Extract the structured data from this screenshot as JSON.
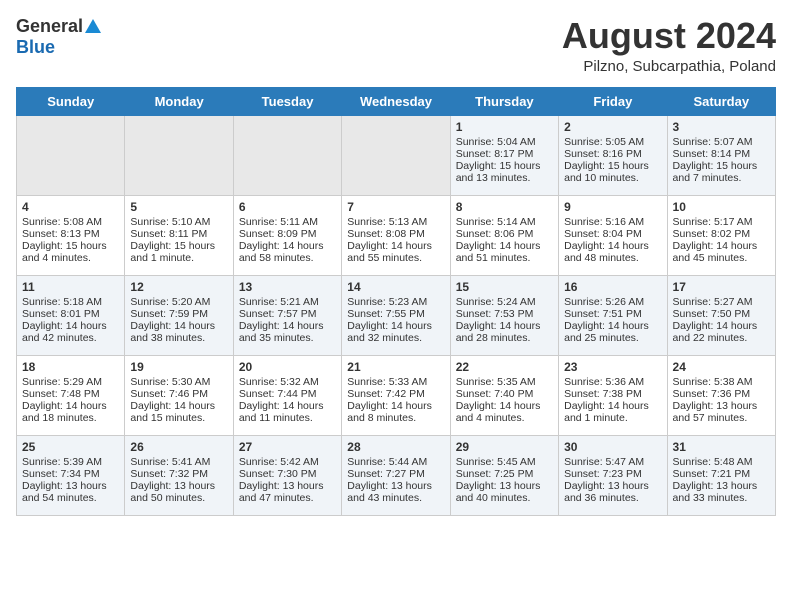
{
  "header": {
    "logo_general": "General",
    "logo_blue": "Blue",
    "month_year": "August 2024",
    "location": "Pilzno, Subcarpathia, Poland"
  },
  "days_of_week": [
    "Sunday",
    "Monday",
    "Tuesday",
    "Wednesday",
    "Thursday",
    "Friday",
    "Saturday"
  ],
  "weeks": [
    [
      {
        "day": "",
        "content": ""
      },
      {
        "day": "",
        "content": ""
      },
      {
        "day": "",
        "content": ""
      },
      {
        "day": "",
        "content": ""
      },
      {
        "day": "1",
        "content": "Sunrise: 5:04 AM\nSunset: 8:17 PM\nDaylight: 15 hours\nand 13 minutes."
      },
      {
        "day": "2",
        "content": "Sunrise: 5:05 AM\nSunset: 8:16 PM\nDaylight: 15 hours\nand 10 minutes."
      },
      {
        "day": "3",
        "content": "Sunrise: 5:07 AM\nSunset: 8:14 PM\nDaylight: 15 hours\nand 7 minutes."
      }
    ],
    [
      {
        "day": "4",
        "content": "Sunrise: 5:08 AM\nSunset: 8:13 PM\nDaylight: 15 hours\nand 4 minutes."
      },
      {
        "day": "5",
        "content": "Sunrise: 5:10 AM\nSunset: 8:11 PM\nDaylight: 15 hours\nand 1 minute."
      },
      {
        "day": "6",
        "content": "Sunrise: 5:11 AM\nSunset: 8:09 PM\nDaylight: 14 hours\nand 58 minutes."
      },
      {
        "day": "7",
        "content": "Sunrise: 5:13 AM\nSunset: 8:08 PM\nDaylight: 14 hours\nand 55 minutes."
      },
      {
        "day": "8",
        "content": "Sunrise: 5:14 AM\nSunset: 8:06 PM\nDaylight: 14 hours\nand 51 minutes."
      },
      {
        "day": "9",
        "content": "Sunrise: 5:16 AM\nSunset: 8:04 PM\nDaylight: 14 hours\nand 48 minutes."
      },
      {
        "day": "10",
        "content": "Sunrise: 5:17 AM\nSunset: 8:02 PM\nDaylight: 14 hours\nand 45 minutes."
      }
    ],
    [
      {
        "day": "11",
        "content": "Sunrise: 5:18 AM\nSunset: 8:01 PM\nDaylight: 14 hours\nand 42 minutes."
      },
      {
        "day": "12",
        "content": "Sunrise: 5:20 AM\nSunset: 7:59 PM\nDaylight: 14 hours\nand 38 minutes."
      },
      {
        "day": "13",
        "content": "Sunrise: 5:21 AM\nSunset: 7:57 PM\nDaylight: 14 hours\nand 35 minutes."
      },
      {
        "day": "14",
        "content": "Sunrise: 5:23 AM\nSunset: 7:55 PM\nDaylight: 14 hours\nand 32 minutes."
      },
      {
        "day": "15",
        "content": "Sunrise: 5:24 AM\nSunset: 7:53 PM\nDaylight: 14 hours\nand 28 minutes."
      },
      {
        "day": "16",
        "content": "Sunrise: 5:26 AM\nSunset: 7:51 PM\nDaylight: 14 hours\nand 25 minutes."
      },
      {
        "day": "17",
        "content": "Sunrise: 5:27 AM\nSunset: 7:50 PM\nDaylight: 14 hours\nand 22 minutes."
      }
    ],
    [
      {
        "day": "18",
        "content": "Sunrise: 5:29 AM\nSunset: 7:48 PM\nDaylight: 14 hours\nand 18 minutes."
      },
      {
        "day": "19",
        "content": "Sunrise: 5:30 AM\nSunset: 7:46 PM\nDaylight: 14 hours\nand 15 minutes."
      },
      {
        "day": "20",
        "content": "Sunrise: 5:32 AM\nSunset: 7:44 PM\nDaylight: 14 hours\nand 11 minutes."
      },
      {
        "day": "21",
        "content": "Sunrise: 5:33 AM\nSunset: 7:42 PM\nDaylight: 14 hours\nand 8 minutes."
      },
      {
        "day": "22",
        "content": "Sunrise: 5:35 AM\nSunset: 7:40 PM\nDaylight: 14 hours\nand 4 minutes."
      },
      {
        "day": "23",
        "content": "Sunrise: 5:36 AM\nSunset: 7:38 PM\nDaylight: 14 hours\nand 1 minute."
      },
      {
        "day": "24",
        "content": "Sunrise: 5:38 AM\nSunset: 7:36 PM\nDaylight: 13 hours\nand 57 minutes."
      }
    ],
    [
      {
        "day": "25",
        "content": "Sunrise: 5:39 AM\nSunset: 7:34 PM\nDaylight: 13 hours\nand 54 minutes."
      },
      {
        "day": "26",
        "content": "Sunrise: 5:41 AM\nSunset: 7:32 PM\nDaylight: 13 hours\nand 50 minutes."
      },
      {
        "day": "27",
        "content": "Sunrise: 5:42 AM\nSunset: 7:30 PM\nDaylight: 13 hours\nand 47 minutes."
      },
      {
        "day": "28",
        "content": "Sunrise: 5:44 AM\nSunset: 7:27 PM\nDaylight: 13 hours\nand 43 minutes."
      },
      {
        "day": "29",
        "content": "Sunrise: 5:45 AM\nSunset: 7:25 PM\nDaylight: 13 hours\nand 40 minutes."
      },
      {
        "day": "30",
        "content": "Sunrise: 5:47 AM\nSunset: 7:23 PM\nDaylight: 13 hours\nand 36 minutes."
      },
      {
        "day": "31",
        "content": "Sunrise: 5:48 AM\nSunset: 7:21 PM\nDaylight: 13 hours\nand 33 minutes."
      }
    ]
  ]
}
